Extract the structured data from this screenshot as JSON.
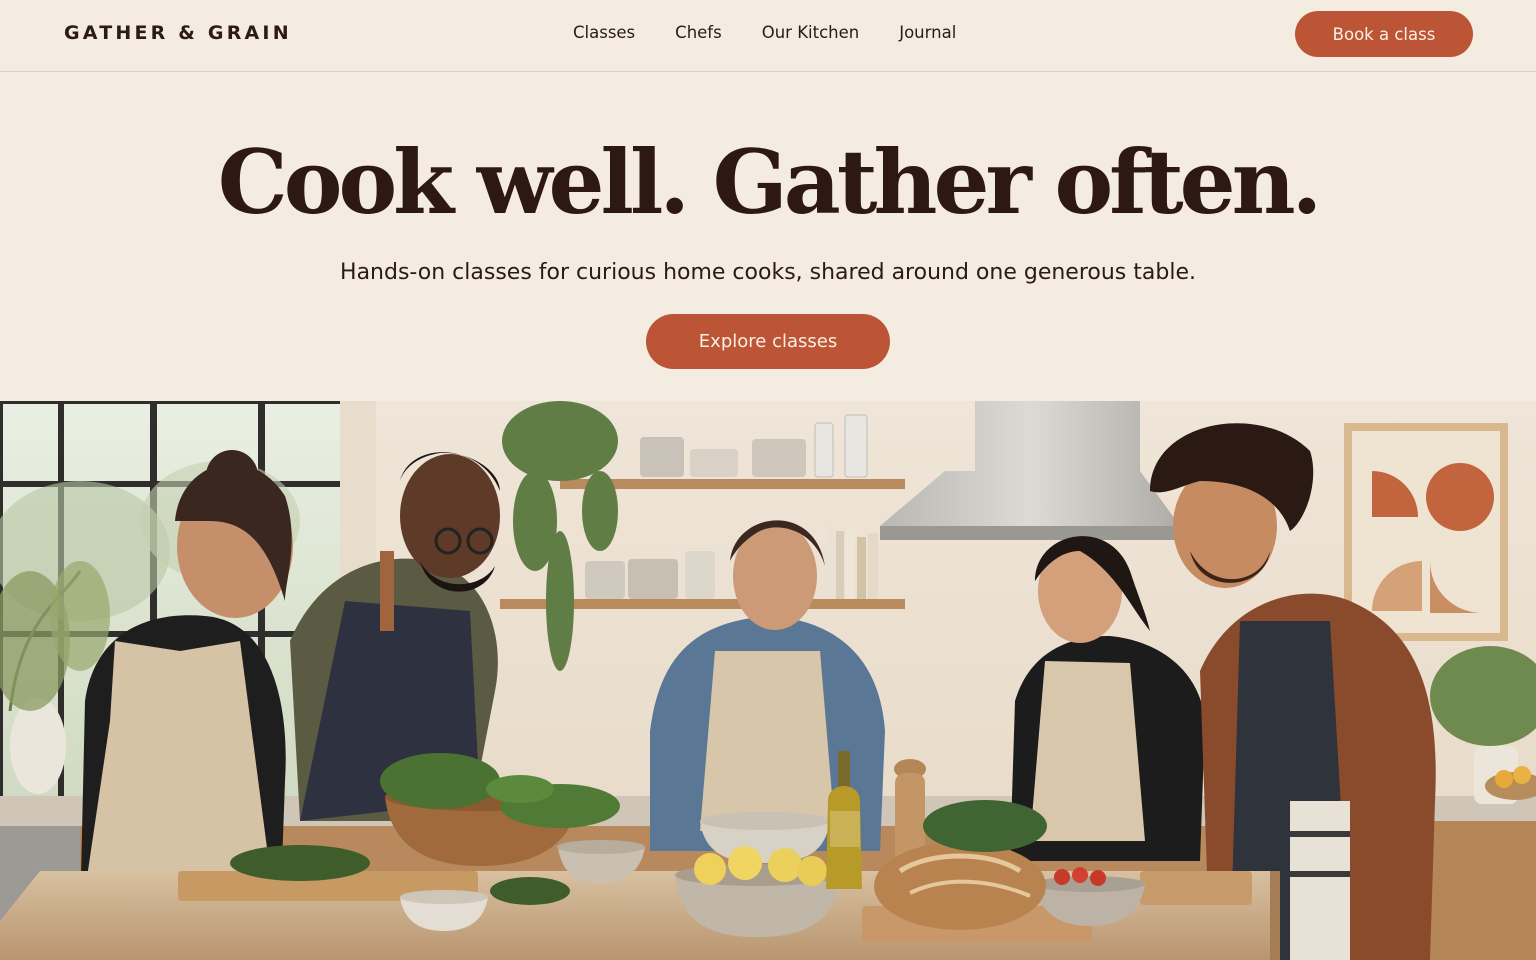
{
  "brand": {
    "name": "GATHER & GRAIN"
  },
  "nav": {
    "links": [
      "Classes",
      "Chefs",
      "Our Kitchen",
      "Journal"
    ],
    "cta_label": "Book a class"
  },
  "hero": {
    "title": "Cook well. Gather often.",
    "subtitle": "Hands-on classes for curious home cooks, shared around one generous table.",
    "cta_label": "Explore classes"
  },
  "colors": {
    "background": "#f4ebe1",
    "accent": "#bc5535",
    "text": "#2b1a15"
  }
}
